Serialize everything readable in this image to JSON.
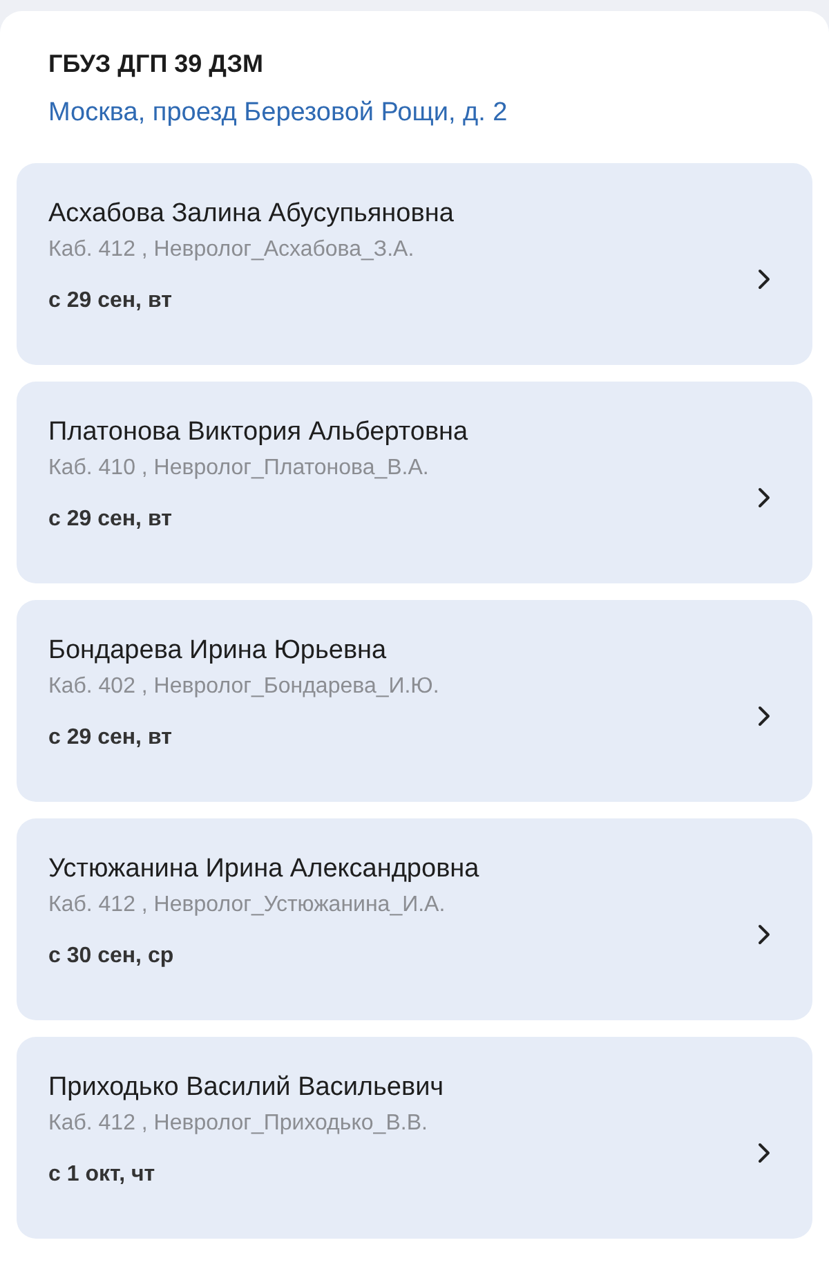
{
  "clinic": {
    "name": "ГБУЗ ДГП 39 ДЗМ",
    "address": "Москва, проезд Березовой Рощи, д. 2"
  },
  "doctors": [
    {
      "name": "Асхабова Залина Абусупьяновна",
      "room": "Каб. 412 , Невролог_Асхабова_З.А.",
      "date": "с 29 сен, вт"
    },
    {
      "name": "Платонова Виктория Альбертовна",
      "room": "Каб. 410 , Невролог_Платонова_В.А.",
      "date": "с 29 сен, вт"
    },
    {
      "name": "Бондарева Ирина Юрьевна",
      "room": "Каб. 402 , Невролог_Бондарева_И.Ю.",
      "date": "с 29 сен, вт"
    },
    {
      "name": "Устюжанина Ирина Александровна",
      "room": "Каб. 412 , Невролог_Устюжанина_И.А.",
      "date": "с 30 сен, ср"
    },
    {
      "name": "Приходько Василий Васильевич",
      "room": "Каб. 412 , Невролог_Приходько_В.В.",
      "date": "с 1 окт, чт"
    }
  ]
}
